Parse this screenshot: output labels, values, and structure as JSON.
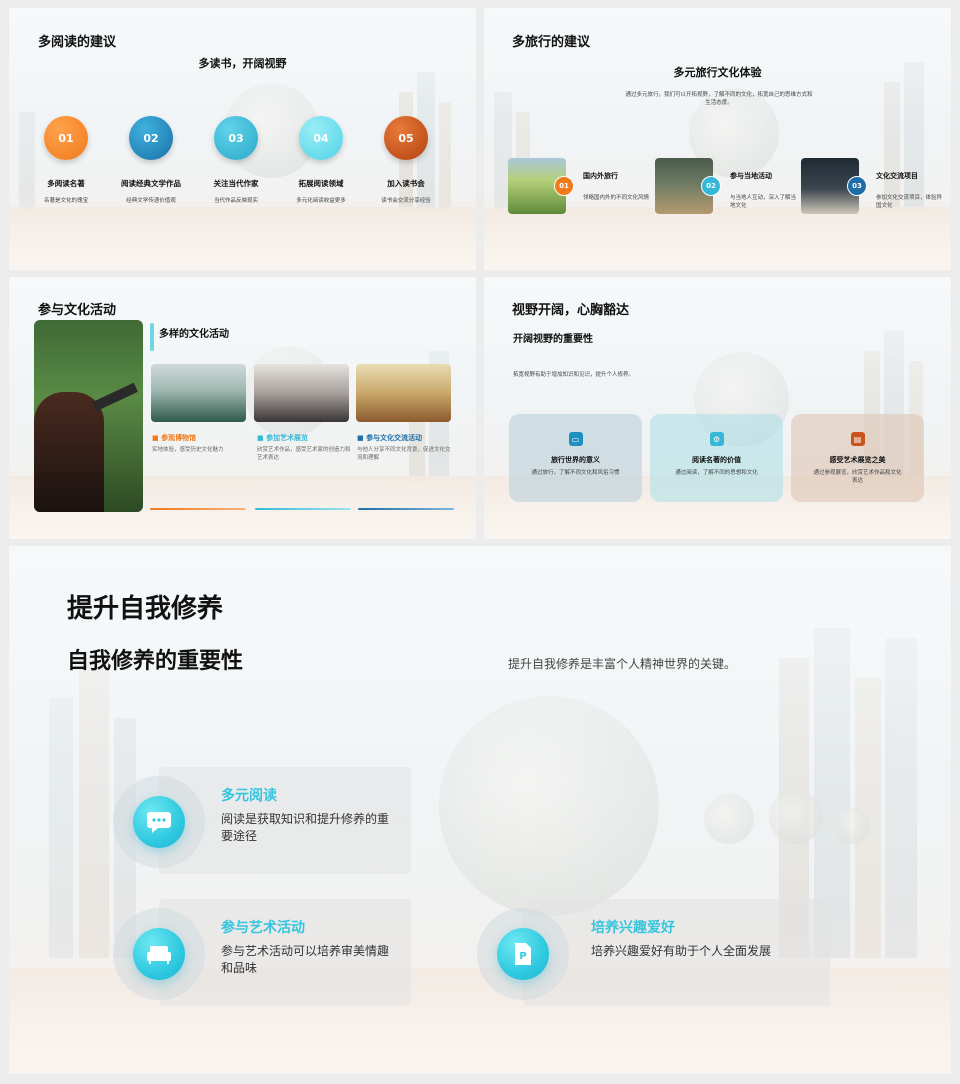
{
  "slide1": {
    "title": "多阅读的建议",
    "subtitle": "多读书，开阔视野",
    "steps": [
      {
        "num": "01",
        "title": "多阅读名著",
        "desc": "名著是文化的瑰宝",
        "color": "#f07a1a"
      },
      {
        "num": "02",
        "title": "阅读经典文学作品",
        "desc": "经典文学传递价值观",
        "color": "#1e8fc0"
      },
      {
        "num": "03",
        "title": "关注当代作家",
        "desc": "当代作品反映现实",
        "color": "#34b8d6"
      },
      {
        "num": "04",
        "title": "拓展阅读领域",
        "desc": "多元化阅读收益更多",
        "color": "#5fd6ea"
      },
      {
        "num": "05",
        "title": "加入读书会",
        "desc": "读书会交流分享经验",
        "color": "#c9531a"
      }
    ]
  },
  "slide2": {
    "title": "多旅行的建议",
    "subtitle": "多元旅行文化体验",
    "intro": "通过多元旅行，我们可以开拓视野，了解不同的文化，拓宽自己的思维方式和生活态度。",
    "cards": [
      {
        "num": "01",
        "title": "国内外旅行",
        "desc": "领略国内外的不同文化风情",
        "color": "#f07a1a"
      },
      {
        "num": "02",
        "title": "参与当地活动",
        "desc": "与当地人互动，深入了解当地文化",
        "color": "#34b8d6"
      },
      {
        "num": "03",
        "title": "文化交流项目",
        "desc": "参加文化交流项目，体验异国文化",
        "color": "#1e6fa8"
      }
    ]
  },
  "slide3": {
    "title": "参与文化活动",
    "subtitle": "多样的文化活动",
    "items": [
      {
        "title": "参观博物馆",
        "desc": "实地体验，感受历史文化魅力",
        "color": "#f07a1a"
      },
      {
        "title": "参加艺术展览",
        "desc": "欣赏艺术作品，感受艺术家的创造力和艺术表达",
        "color": "#34b8d6"
      },
      {
        "title": "参与文化交流活动",
        "desc": "与他人分享不同文化背景，促进文化交流和理解",
        "color": "#1e6fa8"
      }
    ]
  },
  "slide4": {
    "title": "视野开阔，心胸豁达",
    "subtitle": "开阔视野的重要性",
    "intro": "拓宽视野有助于增加知识和见识，提升个人修养。",
    "boxes": [
      {
        "title": "旅行世界的意义",
        "desc": "通过旅行，了解不同文化和风俗习惯",
        "color": "#1e8fc0",
        "icon": "suitcase-icon"
      },
      {
        "title": "阅读名著的价值",
        "desc": "通过阅读，了解不同的思想和文化",
        "color": "#34b8d6",
        "icon": "gear-icon"
      },
      {
        "title": "感受艺术展览之美",
        "desc": "通过参观展览，欣赏艺术作品和文化表达",
        "color": "#c9531a",
        "icon": "book-icon"
      }
    ]
  },
  "slide5": {
    "title": "提升自我修养",
    "subtitle": "自我修养的重要性",
    "note": "提升自我修养是丰富个人精神世界的关键。",
    "items": [
      {
        "title": "多元阅读",
        "desc": "阅读是获取知识和提升修养的重要途径",
        "icon": "chat-icon"
      },
      {
        "title": "参与艺术活动",
        "desc": "参与艺术活动可以培养审美情趣和品味",
        "icon": "sofa-icon"
      },
      {
        "title": "培养兴趣爱好",
        "desc": "培养兴趣爱好有助于个人全面发展",
        "icon": "document-icon"
      }
    ]
  }
}
